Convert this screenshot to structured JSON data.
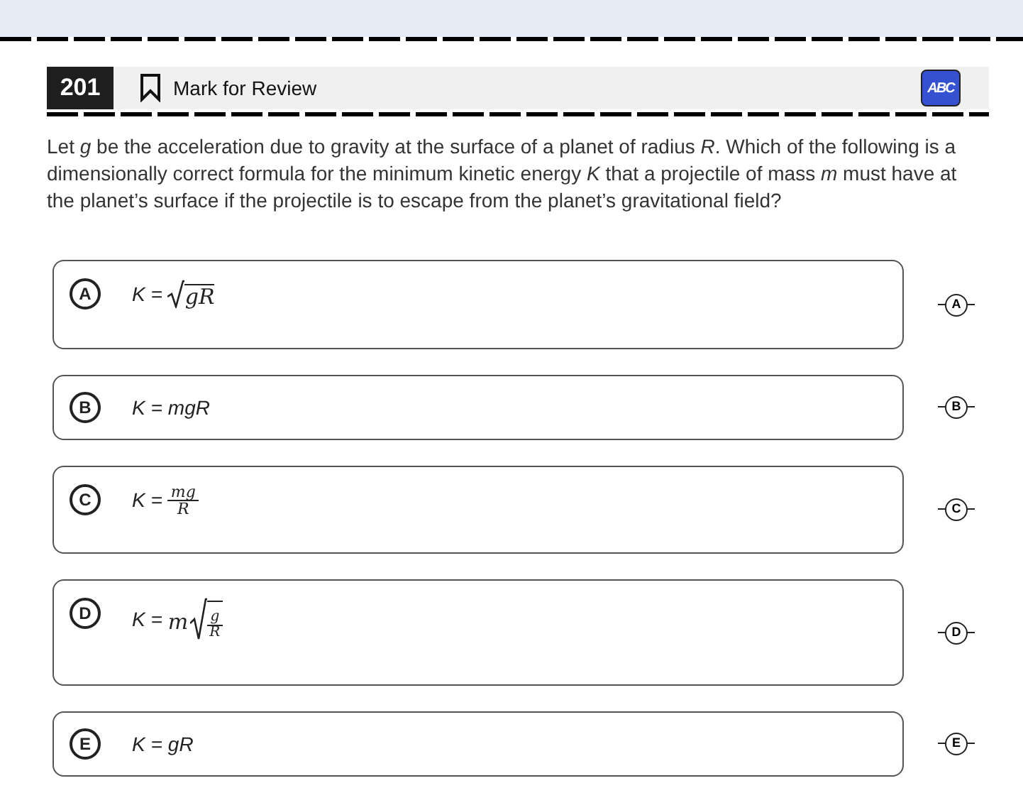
{
  "header": {
    "question_number": "201",
    "mark_for_review": {
      "label": "Mark for Review",
      "selected": false
    },
    "eliminator_tool": {
      "label": "ABC",
      "on": true
    }
  },
  "question": "Let *g* be the acceleration due to gravity at the surface of a planet of radius *R*. Which of the following is a dimensionally correct formula for the minimum kinetic energy *K* that a projectile of mass *m* must have at the planet’s surface if the projectile is to escape from the planet’s gravitational field?",
  "choices": [
    {
      "letter": "A",
      "lhs": "K =",
      "formula": {
        "kind": "sqrt",
        "radicand": "gR"
      },
      "eliminate_label": "A"
    },
    {
      "letter": "B",
      "lhs": "K =",
      "formula": {
        "kind": "plain",
        "text": "mgR"
      },
      "eliminate_label": "B"
    },
    {
      "letter": "C",
      "lhs": "K =",
      "formula": {
        "kind": "fraction",
        "numerator": "mg",
        "denominator": "R"
      },
      "eliminate_label": "C"
    },
    {
      "letter": "D",
      "lhs": "K =",
      "formula": {
        "kind": "coef-sqrt-fraction",
        "coefficient": "m",
        "numerator": "g",
        "denominator": "R"
      },
      "eliminate_label": "D"
    },
    {
      "letter": "E",
      "lhs": "K =",
      "formula": {
        "kind": "plain",
        "text": "gR"
      },
      "eliminate_label": "E"
    }
  ]
}
